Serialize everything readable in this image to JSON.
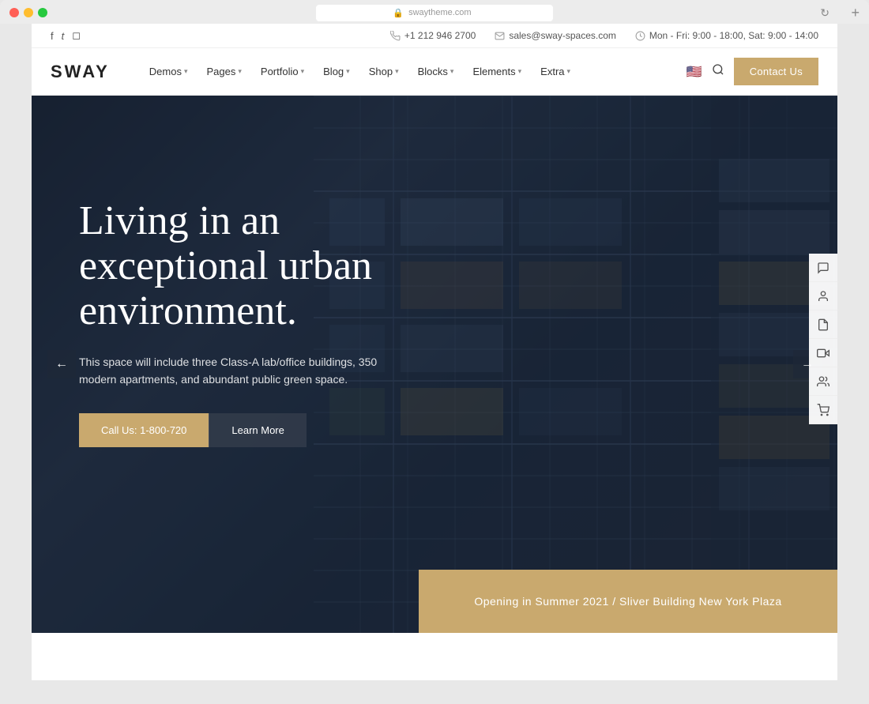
{
  "browser": {
    "url": "swaytheme.com",
    "reload_icon": "↻",
    "new_tab_icon": "+"
  },
  "topbar": {
    "social": {
      "facebook_label": "f",
      "twitter_label": "t",
      "instagram_label": "i"
    },
    "phone": "+1 212 946 2700",
    "email": "sales@sway-spaces.com",
    "hours": "Mon - Fri: 9:00 - 18:00, Sat: 9:00 - 14:00"
  },
  "navbar": {
    "logo": "SWAY",
    "items": [
      {
        "label": "Demos",
        "has_dropdown": true
      },
      {
        "label": "Pages",
        "has_dropdown": true
      },
      {
        "label": "Portfolio",
        "has_dropdown": true
      },
      {
        "label": "Blog",
        "has_dropdown": true
      },
      {
        "label": "Shop",
        "has_dropdown": true
      },
      {
        "label": "Blocks",
        "has_dropdown": true
      },
      {
        "label": "Elements",
        "has_dropdown": true
      },
      {
        "label": "Extra",
        "has_dropdown": true
      }
    ],
    "contact_label": "Contact Us"
  },
  "hero": {
    "title": "Living in an exceptional urban environment.",
    "description": "This space will include three Class-A lab/office buildings, 350 modern apartments, and abundant public green space.",
    "btn_call_label": "Call Us: 1-800-720",
    "btn_learn_label": "Learn More",
    "arrow_left": "←",
    "arrow_right": "→",
    "opening_text": "Opening in Summer 2021 / Sliver Building New York Plaza"
  },
  "sidebar": {
    "icons": [
      "💬",
      "👤",
      "📄",
      "🎬",
      "👥",
      "🛒"
    ]
  }
}
